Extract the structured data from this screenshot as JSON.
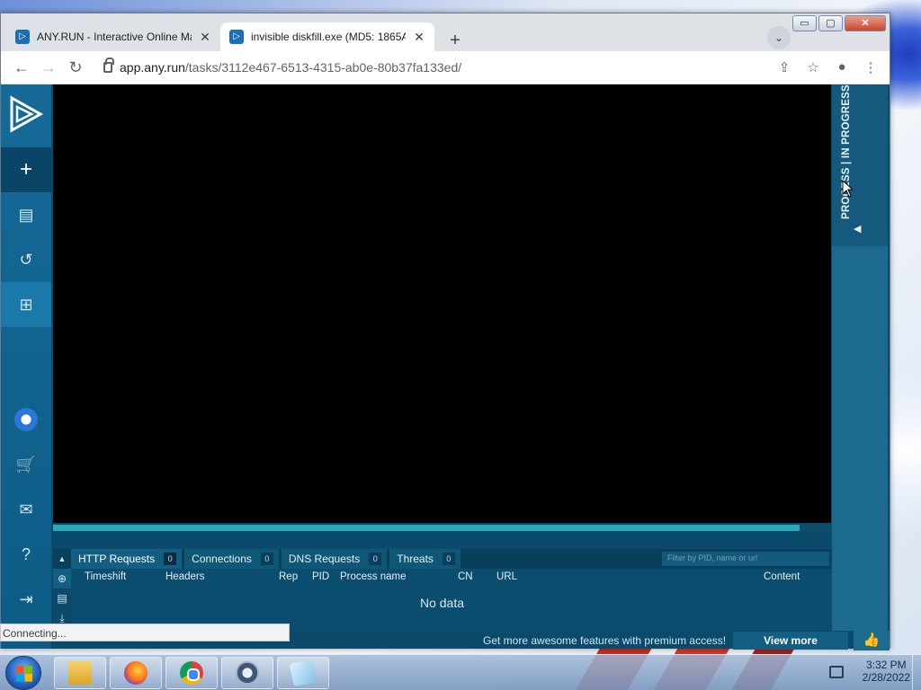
{
  "browser": {
    "tabs": [
      {
        "title": "ANY.RUN - Interactive Online Ma",
        "icon": "anyrun-favicon",
        "active": false
      },
      {
        "title": "invisible diskfill.exe (MD5: 1865A",
        "icon": "anyrun-favicon",
        "active": true
      }
    ],
    "new_tab": "+",
    "url_host": "app.any.run",
    "url_path": "/tasks/3112e467-6513-4315-ab0e-80b37fa133ed/",
    "status_text": "Connecting..."
  },
  "window_controls": {
    "minimize": "▭",
    "maximize": "▢",
    "close": "✕"
  },
  "anyrun": {
    "sidebar": [
      {
        "name": "new-task",
        "icon": "+"
      },
      {
        "name": "reports",
        "icon": "▤"
      },
      {
        "name": "history",
        "icon": "↺"
      },
      {
        "name": "windows",
        "icon": "⊞"
      },
      {
        "name": "cart",
        "icon": "🛒"
      },
      {
        "name": "mail",
        "icon": "✉"
      },
      {
        "name": "help",
        "icon": "?"
      },
      {
        "name": "logout",
        "icon": "⇥"
      }
    ],
    "right_panel_label": "PROCESS | IN PROGRESS",
    "progress": 0.96,
    "net_tabs": [
      {
        "label": "HTTP Requests",
        "count": "0",
        "active": true
      },
      {
        "label": "Connections",
        "count": "0",
        "active": false
      },
      {
        "label": "DNS Requests",
        "count": "0",
        "active": false
      },
      {
        "label": "Threats",
        "count": "0",
        "active": false
      }
    ],
    "filter_placeholder": "Filter by PID, name or url",
    "columns": [
      "Timeshift",
      "Headers",
      "Rep",
      "PID",
      "Process name",
      "CN",
      "URL",
      "Content"
    ],
    "no_data": "No data",
    "promo": "Get more awesome features with premium access!",
    "view_more": "View more"
  },
  "taskbar": {
    "apps": [
      "file-explorer",
      "firefox",
      "chrome",
      "settings",
      "notes"
    ],
    "time": "3:32 PM",
    "date": "2/28/2022"
  },
  "colors": {
    "accent": "#0b4a6b",
    "sidebar": "#156a97",
    "progress": "#2aa7b8"
  }
}
